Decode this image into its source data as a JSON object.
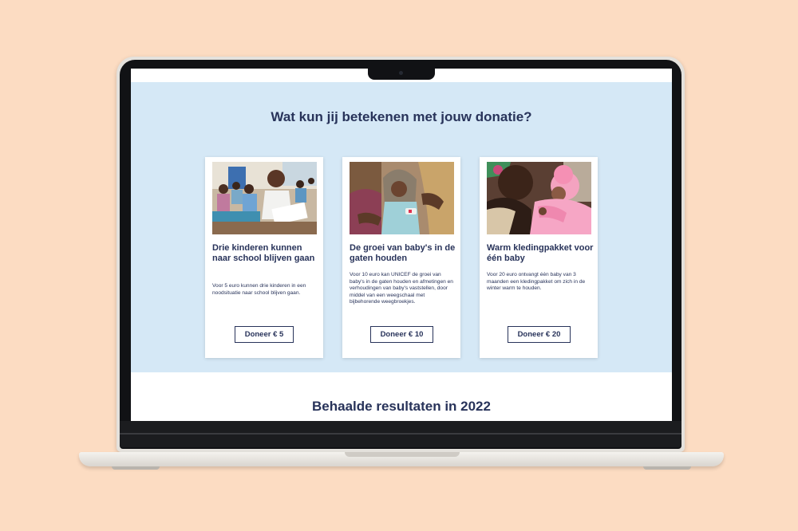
{
  "colors": {
    "backdrop": "#fcdcc2",
    "section_bg": "#d5e8f6",
    "text_navy": "#28335a",
    "card_bg": "#ffffff"
  },
  "donation_section": {
    "title": "Wat kun jij betekenen met jouw donatie?",
    "cards": [
      {
        "image": "children-in-classroom-photo",
        "title": "Drie kinderen kunnen naar school blijven gaan",
        "text": "Voor 5 euro kunnen drie kinderen in een noodsituatie naar school blijven gaan.",
        "button": "Doneer € 5"
      },
      {
        "image": "baby-weighing-photo",
        "title": "De groei van baby's in de gaten houden",
        "text": "Voor 10 euro kan UNICEF de groei van baby's in de gaten houden en afmetingen en verhoudingen van baby's vaststellen, door middel van een weegschaal met bijbehorende weegbroekjes.",
        "button": "Doneer € 10"
      },
      {
        "image": "mother-with-baby-in-pink-photo",
        "title": "Warm kledingpakket voor één baby",
        "text": "Voor 20 euro ontvangt één baby van 3 maanden een kledingpakket om zich in de winter warm te houden.",
        "button": "Doneer € 20"
      }
    ]
  },
  "results_section": {
    "title": "Behaalde resultaten in 2022"
  }
}
